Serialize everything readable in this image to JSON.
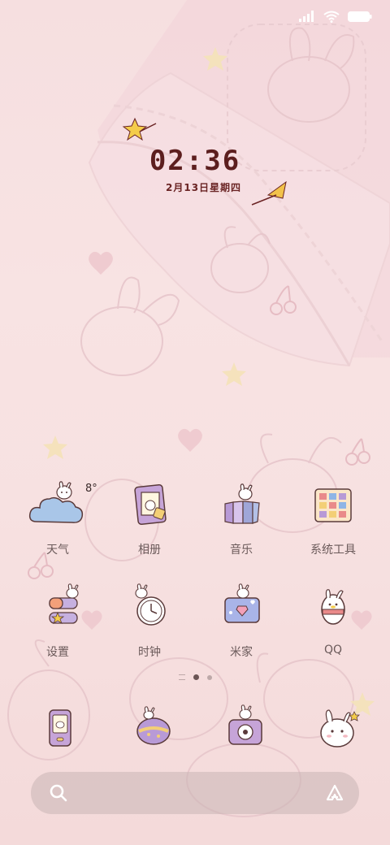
{
  "status_bar": {
    "icons": [
      "signal-icon",
      "wifi-icon",
      "battery-icon"
    ]
  },
  "clock": {
    "time": "02:36",
    "date": "2月13日星期四"
  },
  "apps": [
    {
      "label": "天气",
      "icon": "weather-icon",
      "temp": "8°"
    },
    {
      "label": "相册",
      "icon": "gallery-icon"
    },
    {
      "label": "音乐",
      "icon": "music-icon"
    },
    {
      "label": "系统工具",
      "icon": "system-tools-icon"
    },
    {
      "label": "设置",
      "icon": "settings-icon"
    },
    {
      "label": "时钟",
      "icon": "clock-icon"
    },
    {
      "label": "米家",
      "icon": "mihome-icon"
    },
    {
      "label": "QQ",
      "icon": "qq-icon"
    }
  ],
  "dock": [
    {
      "icon": "phone-icon"
    },
    {
      "icon": "messages-icon"
    },
    {
      "icon": "camera-icon"
    },
    {
      "icon": "browser-icon"
    }
  ],
  "page_indicator": {
    "pages": 2,
    "active": 0
  },
  "search": {
    "placeholder": ""
  },
  "colors": {
    "accent": "#5c1e1e",
    "background": "#f8e3e3",
    "label": "#6b5a5a"
  }
}
